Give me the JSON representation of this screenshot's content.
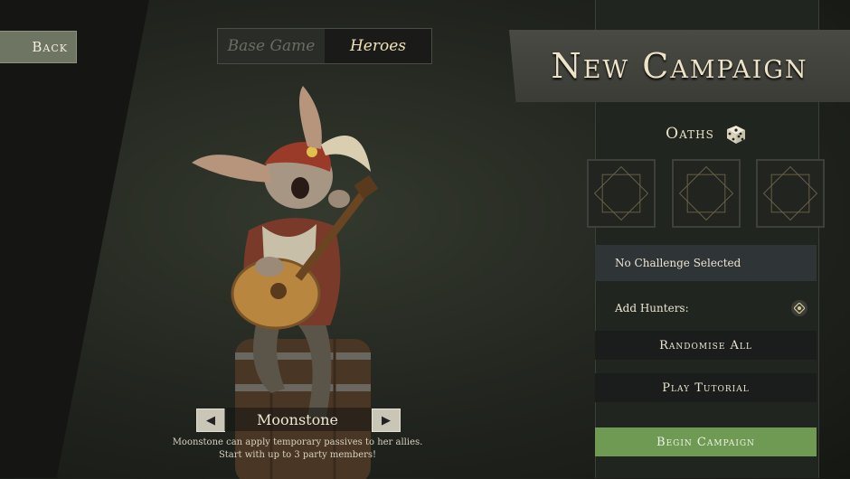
{
  "nav": {
    "back_label": "Back"
  },
  "tabs": [
    {
      "label": "Base Game",
      "active": false
    },
    {
      "label": "Heroes",
      "active": true
    }
  ],
  "hero": {
    "name": "Moonstone",
    "description": "Moonstone can apply temporary passives to her allies. Start with up to 3 party members!",
    "prev_icon": "arrow-left-icon",
    "next_icon": "arrow-right-icon"
  },
  "panel": {
    "title": "New Campaign",
    "oaths_label": "Oaths",
    "oath_slots": 3,
    "challenge_text": "No Challenge Selected",
    "hunters_label": "Add Hunters:",
    "randomise_label": "Randomise All",
    "tutorial_label": "Play Tutorial",
    "begin_label": "Begin Campaign"
  },
  "colors": {
    "accent_green": "#6e9a54",
    "gold_text": "#efe0b5",
    "panel_bg": "#20251f"
  }
}
